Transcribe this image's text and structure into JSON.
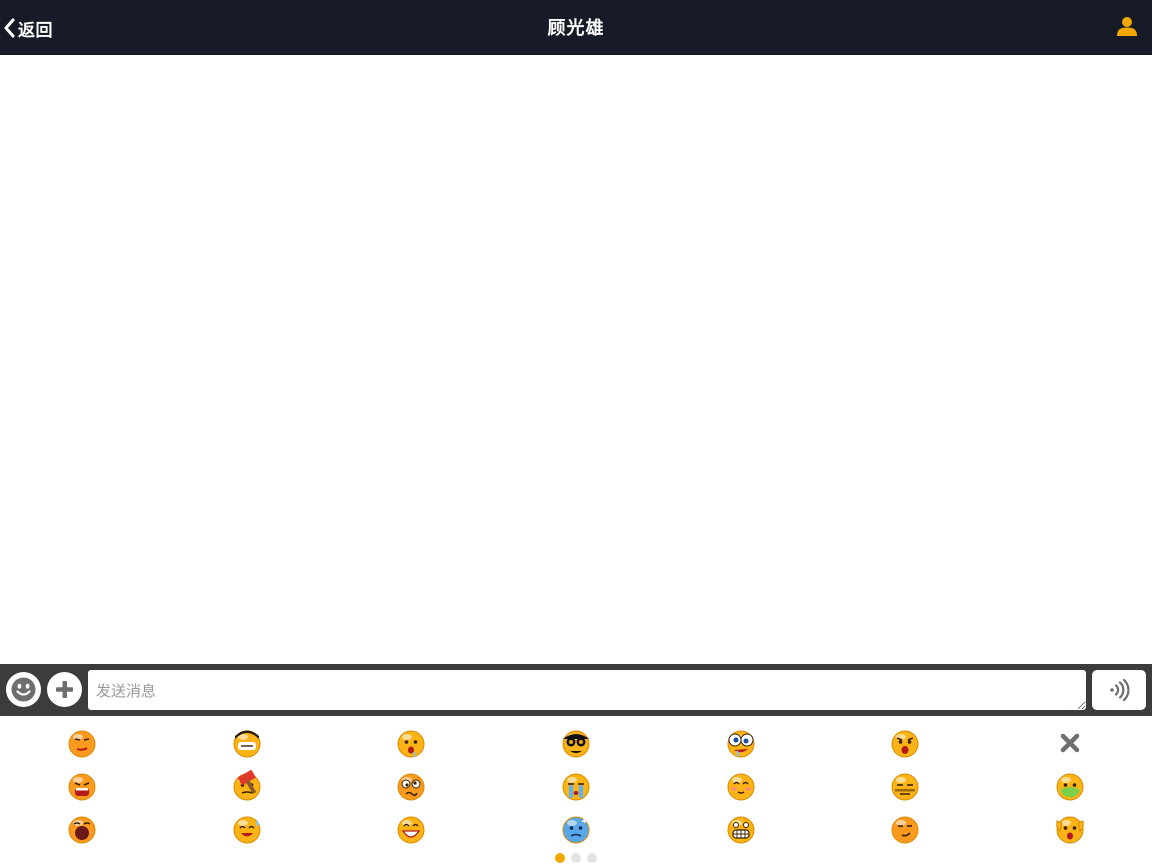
{
  "header": {
    "back_label": "返回",
    "title": "顾光雄",
    "back_icon": "chevron-left-icon",
    "profile_icon": "user-icon"
  },
  "input_bar": {
    "emoji_icon": "smiley-icon",
    "plus_icon": "plus-icon",
    "message_placeholder": "发送消息",
    "message_value": "",
    "voice_icon": "voice-icon"
  },
  "emoji_panel": {
    "rows": [
      [
        "smug",
        "cool-shades",
        "drool",
        "sunglasses",
        "crazy-eyes",
        "shocked",
        "delete"
      ],
      [
        "shout",
        "hammer",
        "confused",
        "crying",
        "shy",
        "speechless",
        "vomit"
      ],
      [
        "yawn",
        "sweat-laugh",
        "grin",
        "freezing",
        "grimace",
        "smirk",
        "surprised-hands"
      ]
    ],
    "pages": 3,
    "active_page": 1
  },
  "colors": {
    "header_bg": "#171a27",
    "input_bar_bg": "#3b3c3d",
    "accent": "#f2a800",
    "emoji_yellow": "#fbb316"
  }
}
